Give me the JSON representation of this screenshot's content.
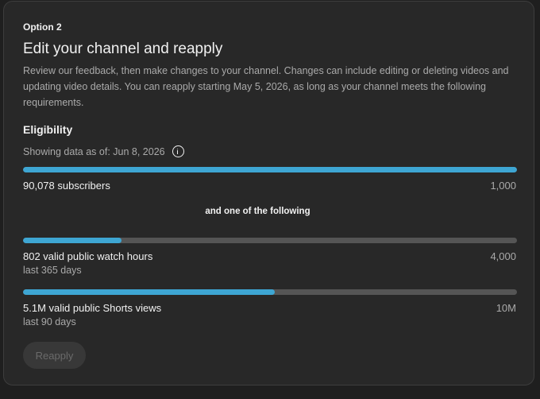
{
  "option": {
    "label": "Option 2",
    "title": "Edit your channel and reapply",
    "description": "Review our feedback, then make changes to your channel. Changes can include editing or deleting videos and updating video details. You can reapply starting May 5, 2026, as long as your channel meets the following requirements."
  },
  "eligibility": {
    "title": "Eligibility",
    "as_of": "Showing data as of: Jun 8, 2026",
    "info_icon": "info-icon",
    "and_one": "and one of the following",
    "metrics": [
      {
        "label": "90,078 subscribers",
        "sub": "",
        "target": "1,000",
        "progress_percent": 100
      },
      {
        "label": "802 valid public watch hours",
        "sub": "last 365 days",
        "target": "4,000",
        "progress_percent": 20
      },
      {
        "label": "5.1M valid public Shorts views",
        "sub": "last 90 days",
        "target": "10M",
        "progress_percent": 51
      }
    ]
  },
  "actions": {
    "reapply_label": "Reapply"
  },
  "colors": {
    "progress_fill": "#3ea6d3",
    "progress_track": "#555555",
    "card_background": "#282828"
  }
}
